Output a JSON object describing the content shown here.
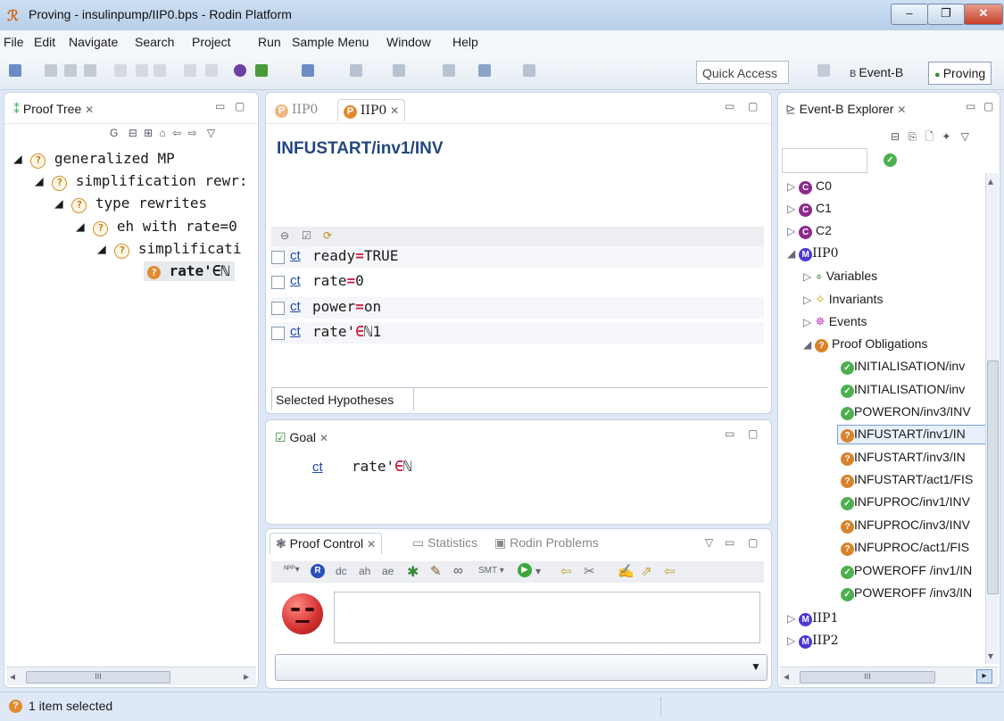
{
  "window": {
    "title": "Proving - insulinpump/IIP0.bps - Rodin Platform"
  },
  "menu": [
    "File",
    "Edit",
    "Navigate",
    "Search",
    "Project",
    "Run",
    "Sample Menu",
    "Window",
    "Help"
  ],
  "toolbar": {
    "quick_access": "Quick Access",
    "perspective_eventb": "Event-B",
    "perspective_proving": "Proving"
  },
  "proof_tree": {
    "tab": "Proof Tree",
    "g_label": "G",
    "nodes": [
      {
        "label": "generalized MP",
        "depth": 0
      },
      {
        "label": "simplification rewr:",
        "depth": 1
      },
      {
        "label": "type rewrites",
        "depth": 2
      },
      {
        "label": "eh with rate=0",
        "depth": 3
      },
      {
        "label": "simplificati",
        "depth": 4
      },
      {
        "label": "rate'∈ℕ",
        "depth": 5
      }
    ]
  },
  "editor": {
    "tabs": [
      "IIP0",
      "IIP0"
    ],
    "heading": "INFUSTART/inv1/INV",
    "hypotheses": [
      {
        "link": "ct",
        "lhs": "ready",
        "op": "=",
        "rhs": "TRUE"
      },
      {
        "link": "ct",
        "lhs": "rate",
        "op": "=",
        "rhs": "0"
      },
      {
        "link": "ct",
        "lhs": "power",
        "op": "=",
        "rhs": "on"
      },
      {
        "link": "ct",
        "lhs": "rate'",
        "op": "∈",
        "rhs": "ℕ1"
      }
    ],
    "selected_hypotheses_label": "Selected Hypotheses"
  },
  "goal": {
    "tab": "Goal",
    "link": "ct",
    "lhs": "rate'",
    "op": "∈",
    "rhs": "ℕ"
  },
  "proof_control": {
    "tabs": [
      "Proof Control",
      "Statistics",
      "Rodin Problems"
    ],
    "buttons": [
      "dc",
      "ah",
      "ae",
      "SMT"
    ]
  },
  "explorer": {
    "tab": "Event-B Explorer",
    "contexts": [
      "C0",
      "C1",
      "C2"
    ],
    "machine": "IIP0",
    "machine_children": [
      "Variables",
      "Invariants",
      "Events",
      "Proof Obligations"
    ],
    "proof_obligations": [
      {
        "label": "INITIALISATION/inv",
        "status": "ok"
      },
      {
        "label": "INITIALISATION/inv",
        "status": "ok"
      },
      {
        "label": "POWERON/inv3/INV",
        "status": "ok"
      },
      {
        "label": "INFUSTART/inv1/IN",
        "status": "bad"
      },
      {
        "label": "INFUSTART/inv3/IN",
        "status": "bad"
      },
      {
        "label": "INFUSTART/act1/FIS",
        "status": "bad"
      },
      {
        "label": "INFUPROC/inv1/INV",
        "status": "ok"
      },
      {
        "label": "INFUPROC/inv3/INV",
        "status": "bad"
      },
      {
        "label": "INFUPROC/act1/FIS",
        "status": "bad"
      },
      {
        "label": "POWEROFF /inv1/IN",
        "status": "ok"
      },
      {
        "label": "POWEROFF /inv3/IN",
        "status": "ok"
      }
    ],
    "other_machines": [
      "IIP1",
      "IIP2"
    ]
  },
  "status": {
    "text": "1 item selected"
  },
  "scroll": {
    "grip": "III"
  }
}
